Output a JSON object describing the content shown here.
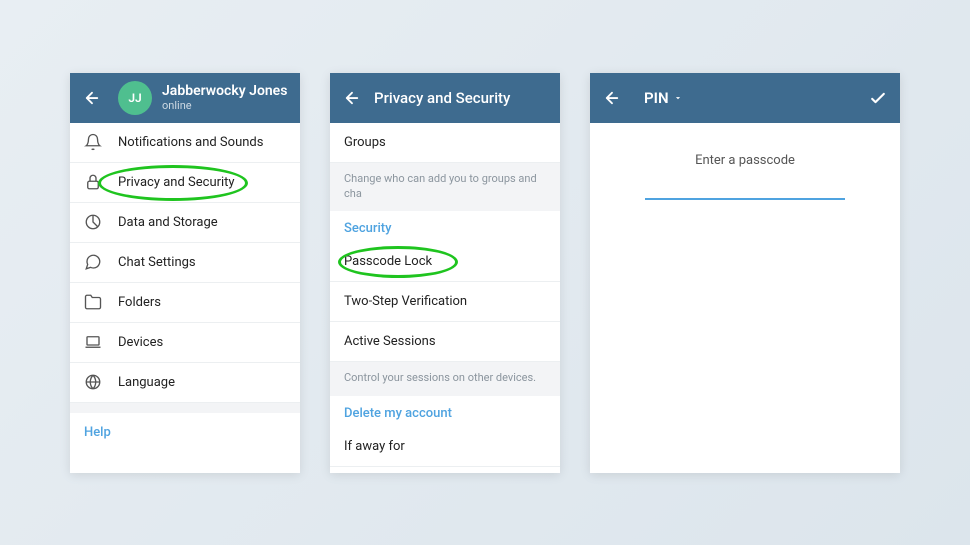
{
  "screen1": {
    "user": {
      "initials": "JJ",
      "name": "Jabberwocky Jones",
      "status": "online"
    },
    "items": [
      {
        "label": "Notifications and Sounds",
        "icon": "bell"
      },
      {
        "label": "Privacy and Security",
        "icon": "lock",
        "highlighted": true
      },
      {
        "label": "Data and Storage",
        "icon": "pie"
      },
      {
        "label": "Chat Settings",
        "icon": "chat"
      },
      {
        "label": "Folders",
        "icon": "folder"
      },
      {
        "label": "Devices",
        "icon": "laptop"
      },
      {
        "label": "Language",
        "icon": "globe"
      }
    ],
    "help": "Help"
  },
  "screen2": {
    "title": "Privacy and Security",
    "groups_item": "Groups",
    "groups_desc": "Change who can add you to groups and cha",
    "security_header": "Security",
    "security_items": [
      {
        "label": "Passcode Lock",
        "highlighted": true
      },
      {
        "label": "Two-Step Verification"
      },
      {
        "label": "Active Sessions"
      }
    ],
    "sessions_desc": "Control your sessions on other devices.",
    "delete_header": "Delete my account",
    "delete_item": "If away for"
  },
  "screen3": {
    "pin_label": "PIN",
    "prompt": "Enter a passcode"
  },
  "icons": {
    "bell": "bell-icon",
    "lock": "lock-icon",
    "pie": "pie-icon",
    "chat": "chat-icon",
    "folder": "folder-icon",
    "laptop": "laptop-icon",
    "globe": "globe-icon"
  }
}
